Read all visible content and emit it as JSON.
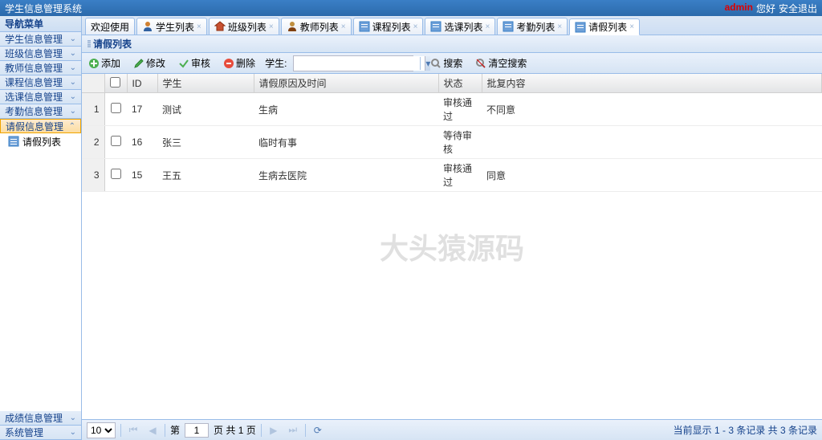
{
  "app_title": "学生信息管理系统",
  "header": {
    "user": "admin",
    "hello": "您好",
    "logout": "安全退出"
  },
  "sidebar": {
    "title": "导航菜单",
    "items": [
      {
        "label": "学生信息管理"
      },
      {
        "label": "班级信息管理"
      },
      {
        "label": "教师信息管理"
      },
      {
        "label": "课程信息管理"
      },
      {
        "label": "选课信息管理"
      },
      {
        "label": "考勤信息管理"
      },
      {
        "label": "请假信息管理"
      }
    ],
    "sub_items": [
      {
        "label": "请假列表"
      }
    ],
    "bottom_items": [
      {
        "label": "成绩信息管理"
      },
      {
        "label": "系统管理"
      }
    ]
  },
  "tabs": [
    {
      "label": "欢迎使用"
    },
    {
      "label": "学生列表"
    },
    {
      "label": "班级列表"
    },
    {
      "label": "教师列表"
    },
    {
      "label": "课程列表"
    },
    {
      "label": "选课列表"
    },
    {
      "label": "考勤列表"
    },
    {
      "label": "请假列表"
    }
  ],
  "panel": {
    "title": "请假列表"
  },
  "toolbar": {
    "add": "添加",
    "edit": "修改",
    "review": "审核",
    "delete": "删除",
    "student_label": "学生:",
    "search": "搜索",
    "clear": "清空搜索"
  },
  "grid": {
    "columns": [
      "ID",
      "学生",
      "请假原因及时间",
      "状态",
      "批复内容"
    ],
    "rows": [
      {
        "rn": 1,
        "id": 17,
        "student": "测试",
        "reason": "生病",
        "status": "审核通过",
        "reply": "不同意"
      },
      {
        "rn": 2,
        "id": 16,
        "student": "张三",
        "reason": "临时有事",
        "status": "等待审核",
        "reply": ""
      },
      {
        "rn": 3,
        "id": 15,
        "student": "王五",
        "reason": "生病去医院",
        "status": "审核通过",
        "reply": "同意"
      }
    ]
  },
  "watermark": "大头猿源码",
  "pager": {
    "page_size": "10",
    "page_label_prefix": "第",
    "current_page": "1",
    "page_label_mid": "页 共",
    "total_pages": "1",
    "page_label_suffix": "页",
    "info": "当前显示 1 - 3 条记录 共 3 条记录"
  }
}
